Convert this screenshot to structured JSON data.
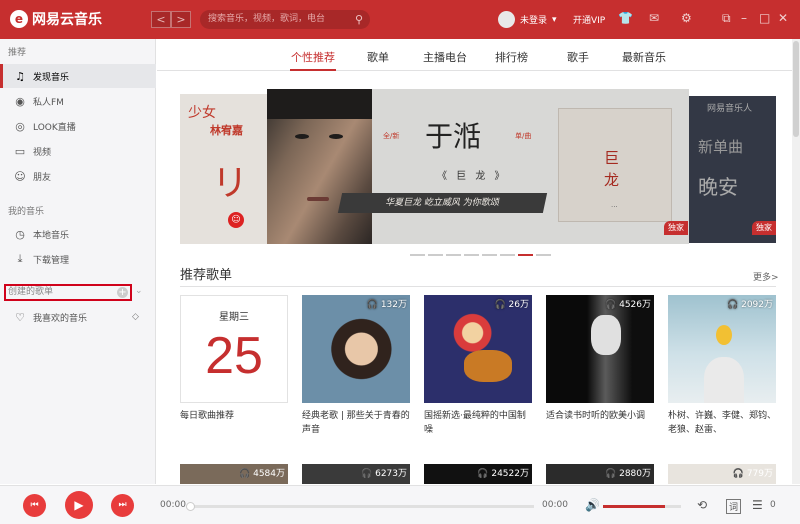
{
  "app": {
    "title": "网易云音乐",
    "logo_glyph": "e"
  },
  "header": {
    "back": "<",
    "forward": ">",
    "search_placeholder": "搜索音乐，视频，歌词，电台",
    "user_label": "未登录",
    "user_caret": "▾",
    "vip_label": "开通VIP",
    "icons": [
      "skin-icon",
      "mail-icon",
      "settings-icon",
      "mini-mode-icon",
      "minimize-icon",
      "maximize-icon",
      "close-icon"
    ]
  },
  "sidebar": {
    "section_recommend": "推荐",
    "items_recommend": [
      {
        "label": "发现音乐",
        "icon": "music-note-icon",
        "active": true
      },
      {
        "label": "私人FM",
        "icon": "radio-icon"
      },
      {
        "label": "LOOK直播",
        "icon": "live-icon"
      },
      {
        "label": "视频",
        "icon": "video-icon"
      },
      {
        "label": "朋友",
        "icon": "friends-icon"
      }
    ],
    "section_my_music": "我的音乐",
    "items_my_music": [
      {
        "label": "本地音乐",
        "icon": "local-music-icon"
      },
      {
        "label": "下载管理",
        "icon": "download-icon"
      }
    ],
    "created_playlists": "创建的歌单",
    "created_items": [
      {
        "label": "我喜欢的音乐",
        "icon": "heart-icon"
      }
    ]
  },
  "tabs": [
    {
      "label": "个性推荐",
      "active": true
    },
    {
      "label": "歌单"
    },
    {
      "label": "主播电台"
    },
    {
      "label": "排行榜"
    },
    {
      "label": "歌手"
    },
    {
      "label": "最新音乐"
    }
  ],
  "banner": {
    "left_artist": "林宥嘉",
    "left_tag": "少女",
    "left_script": "リ",
    "center_label_1": "全/新",
    "center_artist": "于湉",
    "center_label_2": "单/曲",
    "center_song": "《 巨 龙 》",
    "center_slogan": "华夏巨龙 屹立威风 为你歌颂",
    "center_cover_text": "巨龙",
    "center_cover_dots": "...",
    "right_logo": "网易音乐人",
    "right_text_1": "新单曲",
    "right_text_2": "晚安",
    "badge_exclusive": "独家",
    "dot_count": 8,
    "active_dot": 6
  },
  "recommended": {
    "title": "推荐歌单",
    "more": "更多>",
    "daily": {
      "weekday": "星期三",
      "day": "25",
      "caption": "每日歌曲推荐"
    },
    "playlists": [
      {
        "plays": "132万",
        "caption": "经典老歌 | 那些关于青春的声音"
      },
      {
        "plays": "26万",
        "caption": "国摇新选·最纯粹的中国制噪"
      },
      {
        "plays": "4526万",
        "caption": "适合读书时听的欧美小调"
      },
      {
        "plays": "2092万",
        "caption": "朴树、许巍、李健、郑钧、老狼、赵雷、"
      }
    ],
    "row2_plays": [
      "4584万",
      "6273万",
      "24522万",
      "2880万",
      "779万"
    ]
  },
  "player": {
    "time_current": "00:00",
    "time_total": "00:00",
    "progress": 0,
    "volume": 0.8,
    "lyrics_label": "词",
    "playlist_count": "0"
  }
}
